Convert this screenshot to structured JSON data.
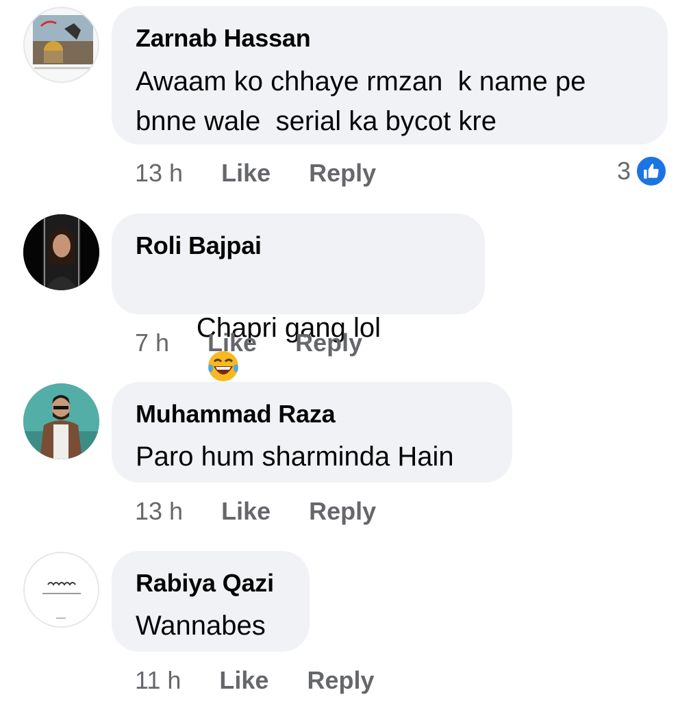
{
  "comments": [
    {
      "author": "Zarnab Hassan",
      "text": "Awaam ko chhaye rmzan  k name pe\nbnne wale  serial ka bycot kre",
      "time": "13 h",
      "like": "Like",
      "reply": "Reply",
      "reaction_count": "3",
      "avatar_icon": "profile-photo-icon"
    },
    {
      "author": "Roli Bajpai",
      "text": "Chapri gang lol",
      "emojis": [
        "face-with-tears-of-joy",
        "face-with-tears-of-joy",
        "face-with-tears-of-joy"
      ],
      "time": "7 h",
      "like": "Like",
      "reply": "Reply",
      "avatar_icon": "profile-photo-icon"
    },
    {
      "author": "Muhammad Raza",
      "text": "Paro hum sharminda Hain",
      "time": "13 h",
      "like": "Like",
      "reply": "Reply",
      "avatar_icon": "profile-photo-icon"
    },
    {
      "author": "Rabiya Qazi",
      "text": "Wannabes",
      "time": "11 h",
      "like": "Like",
      "reply": "Reply",
      "avatar_icon": "profile-photo-icon"
    }
  ],
  "colors": {
    "bubble": "#f0f2f5",
    "meta_text": "#65676b",
    "like_badge": "#1b74e4"
  }
}
